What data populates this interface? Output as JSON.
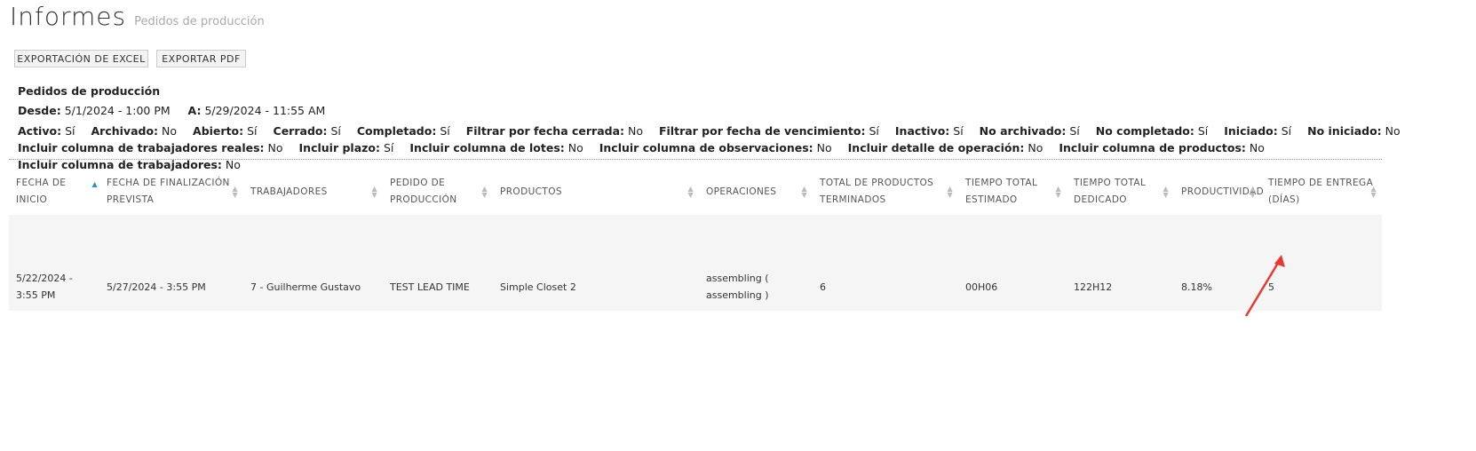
{
  "header": {
    "title": "Informes",
    "subtitle": "Pedidos de producción"
  },
  "toolbar": {
    "excel_label": "EXPORTACIÓN DE EXCEL",
    "pdf_label": "EXPORTAR PDF"
  },
  "report": {
    "name": "Pedidos de producción",
    "from_label": "Desde:",
    "from_value": "5/1/2024 - 1:00 PM",
    "to_label": "A:",
    "to_value": "5/29/2024 - 11:55 AM",
    "flags": [
      {
        "label": "Activo:",
        "value": "Sí"
      },
      {
        "label": "Archivado:",
        "value": "No"
      },
      {
        "label": "Abierto:",
        "value": "Sí"
      },
      {
        "label": "Cerrado:",
        "value": "Sí"
      },
      {
        "label": "Completado:",
        "value": "Sí"
      },
      {
        "label": "Filtrar por fecha cerrada:",
        "value": "No"
      },
      {
        "label": "Filtrar por fecha de vencimiento:",
        "value": "Sí"
      },
      {
        "label": "Inactivo:",
        "value": "Sí"
      },
      {
        "label": "No archivado:",
        "value": "Sí"
      },
      {
        "label": "No completado:",
        "value": "Sí"
      },
      {
        "label": "Iniciado:",
        "value": "Sí"
      },
      {
        "label": "No iniciado:",
        "value": "No"
      },
      {
        "label": "Incluir columna de trabajadores reales:",
        "value": "No"
      },
      {
        "label": "Incluir plazo:",
        "value": "Sí"
      },
      {
        "label": "Incluir columna de lotes:",
        "value": "No"
      },
      {
        "label": "Incluir columna de observaciones:",
        "value": "No"
      },
      {
        "label": "Incluir detalle de operación:",
        "value": "No"
      },
      {
        "label": "Incluir columna de productos:",
        "value": "No"
      },
      {
        "label": "Incluir columna de trabajadores:",
        "value": "No"
      }
    ]
  },
  "table": {
    "columns": [
      {
        "label": "FECHA DE INICIO"
      },
      {
        "label": "FECHA DE FINALIZACIÓN PREVISTA"
      },
      {
        "label": "TRABAJADORES"
      },
      {
        "label": "PEDIDO DE PRODUCCIÓN"
      },
      {
        "label": "PRODUCTOS"
      },
      {
        "label": "OPERACIONES"
      },
      {
        "label": "TOTAL DE PRODUCTOS TERMINADOS"
      },
      {
        "label": "TIEMPO TOTAL ESTIMADO"
      },
      {
        "label": "TIEMPO TOTAL DEDICADO"
      },
      {
        "label": "PRODUCTIVIDAD"
      },
      {
        "label": "TIEMPO DE ENTREGA (DÍAS)"
      }
    ],
    "rows": [
      {
        "start": "5/22/2024 - 3:55 PM",
        "planned_end": "5/27/2024 - 3:55 PM",
        "workers": "7 - Guilherme Gustavo",
        "order": "TEST LEAD TIME",
        "products": "Simple Closet 2",
        "operations": "assembling ( assembling )",
        "finished": "6",
        "estimated": "00H06",
        "spent": "122H12",
        "productivity": "8.18%",
        "lead_time": "5"
      }
    ]
  },
  "colors": {
    "accent": "#2b8fd6",
    "annotation_arrow": "#e53935"
  }
}
